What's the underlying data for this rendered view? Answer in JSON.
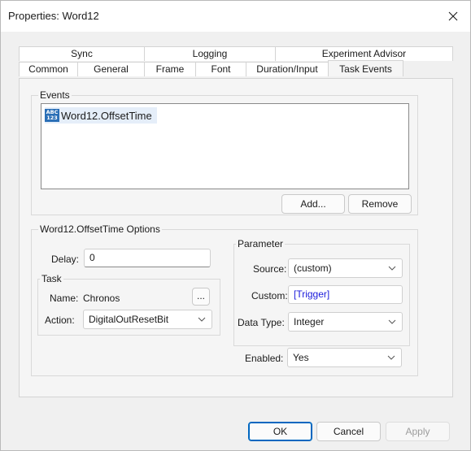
{
  "window": {
    "title": "Properties: Word12"
  },
  "tabs": {
    "row_back": [
      "Sync",
      "Logging",
      "Experiment Advisor"
    ],
    "row_front": [
      "Common",
      "General",
      "Frame",
      "Font",
      "Duration/Input",
      "Task Events"
    ],
    "active": "Task Events"
  },
  "events": {
    "group_label": "Events",
    "items": [
      "Word12.OffsetTime"
    ],
    "add_label": "Add...",
    "remove_label": "Remove"
  },
  "options": {
    "group_label": "Word12.OffsetTime Options",
    "delay_label": "Delay:",
    "delay_value": "0",
    "task": {
      "group_label": "Task",
      "name_label": "Name:",
      "name_value": "Chronos",
      "browse_label": "...",
      "action_label": "Action:",
      "action_value": "DigitalOutResetBit"
    },
    "parameter": {
      "group_label": "Parameter",
      "source_label": "Source:",
      "source_value": "(custom)",
      "custom_label": "Custom:",
      "custom_value": "[Trigger]",
      "custom_color": "#1a1adb",
      "datatype_label": "Data Type:",
      "datatype_value": "Integer"
    },
    "enabled_label": "Enabled:",
    "enabled_value": "Yes"
  },
  "footer": {
    "ok_label": "OK",
    "cancel_label": "Cancel",
    "apply_label": "Apply"
  },
  "icons": {
    "close": "close-icon",
    "event_type": "abc-123-icon",
    "dropdown": "chevron-down-icon"
  }
}
